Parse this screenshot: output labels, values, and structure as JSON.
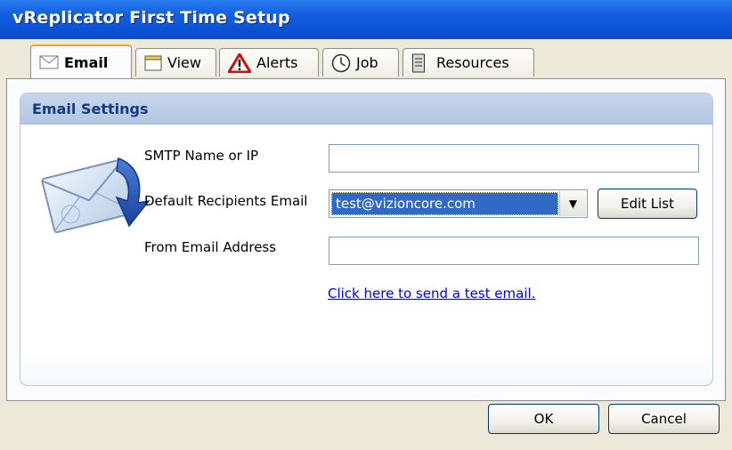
{
  "window": {
    "title": "vReplicator First Time Setup"
  },
  "tabs": [
    {
      "label": "Email",
      "icon": "envelope-icon"
    },
    {
      "label": "View",
      "icon": "window-icon"
    },
    {
      "label": "Alerts",
      "icon": "warning-icon"
    },
    {
      "label": "Job",
      "icon": "clock-icon"
    },
    {
      "label": "Resources",
      "icon": "server-icon"
    }
  ],
  "email_settings": {
    "header": "Email Settings",
    "smtp_label": "SMTP Name or IP",
    "smtp_value": "",
    "recipients_label": "Default Recipients Email",
    "recipients_selected": "test@vizioncore.com",
    "edit_list_label": "Edit List",
    "from_label": "From Email Address",
    "from_value": "",
    "test_link": "Click here to send a test email."
  },
  "footer": {
    "ok_label": "OK",
    "cancel_label": "Cancel"
  }
}
